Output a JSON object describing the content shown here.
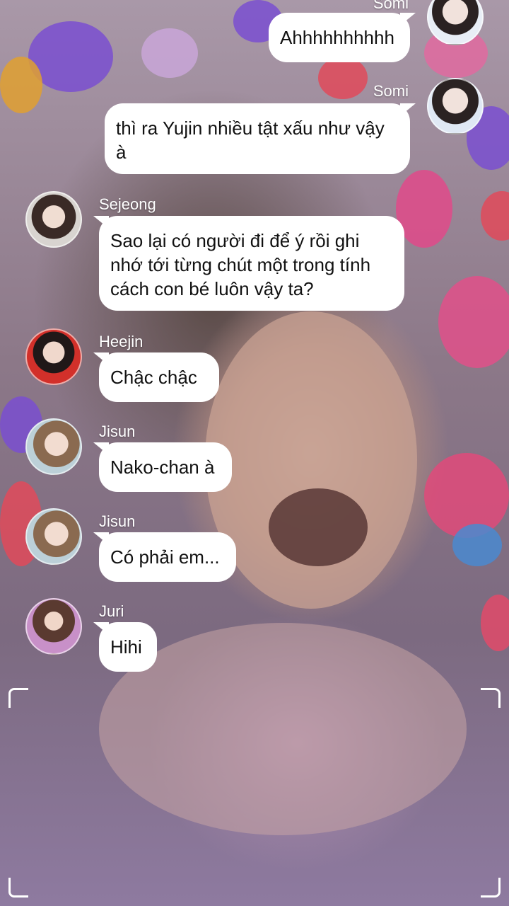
{
  "messages": [
    {
      "sender": "Somi",
      "text": "Ahhhhhhhhhh",
      "side": "right",
      "avatar_icon": "somi-avatar"
    },
    {
      "sender": "Somi",
      "text": "thì ra Yujin nhiều tật xấu như vậy à",
      "side": "right",
      "avatar_icon": "somi-avatar"
    },
    {
      "sender": "Sejeong",
      "text": "Sao lại có người đi để ý rồi ghi nhớ tới từng chút một trong tính cách con bé luôn vậy ta?",
      "side": "left",
      "avatar_icon": "sejeong-avatar"
    },
    {
      "sender": "Heejin",
      "text": "Chậc chậc",
      "side": "left",
      "avatar_icon": "heejin-avatar"
    },
    {
      "sender": "Jisun",
      "text": "Nako-chan à",
      "side": "left",
      "avatar_icon": "jisun-avatar"
    },
    {
      "sender": "Jisun",
      "text": "Có phải em...",
      "side": "left",
      "avatar_icon": "jisun-avatar"
    },
    {
      "sender": "Juri",
      "text": "Hihi",
      "side": "left",
      "avatar_icon": "juri-avatar"
    }
  ],
  "colors": {
    "bubble": "#ffffff",
    "text": "#111111",
    "sender": "#ffffff"
  }
}
